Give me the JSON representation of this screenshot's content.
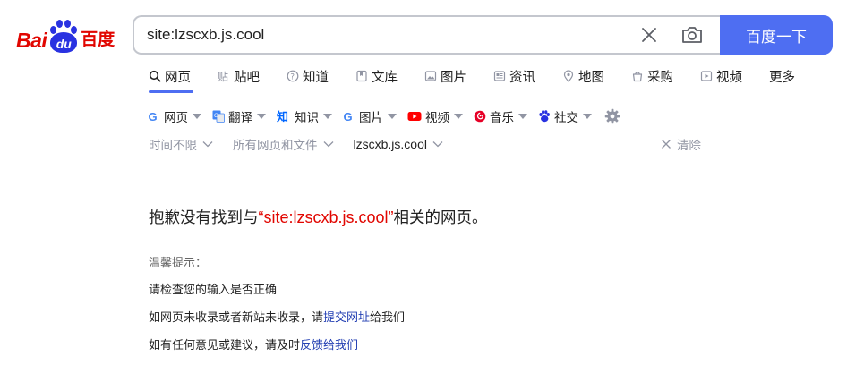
{
  "logo": {
    "latin": "Bai",
    "paw_text": "du",
    "chinese": "百度"
  },
  "search": {
    "query": "site:lzscxb.js.cool",
    "button_label": "百度一下"
  },
  "tabs": [
    {
      "label": "网页",
      "icon": "search-icon",
      "active": true
    },
    {
      "label": "贴吧",
      "icon": "tieba-icon",
      "active": false
    },
    {
      "label": "知道",
      "icon": "question-icon",
      "active": false
    },
    {
      "label": "文库",
      "icon": "document-icon",
      "active": false
    },
    {
      "label": "图片",
      "icon": "image-icon",
      "active": false
    },
    {
      "label": "资讯",
      "icon": "news-icon",
      "active": false
    },
    {
      "label": "地图",
      "icon": "map-pin-icon",
      "active": false
    },
    {
      "label": "采购",
      "icon": "shopping-icon",
      "active": false
    },
    {
      "label": "视频",
      "icon": "video-icon",
      "active": false
    },
    {
      "label": "更多",
      "icon": "",
      "active": false
    }
  ],
  "tools": [
    {
      "label": "网页",
      "icon": "google-icon"
    },
    {
      "label": "翻译",
      "icon": "translate-icon"
    },
    {
      "label": "知识",
      "icon": "zhihu-icon"
    },
    {
      "label": "图片",
      "icon": "google-icon"
    },
    {
      "label": "视频",
      "icon": "youtube-icon"
    },
    {
      "label": "音乐",
      "icon": "netease-music-icon"
    },
    {
      "label": "社交",
      "icon": "baidu-paw-icon"
    }
  ],
  "filters": {
    "time": "时间不限",
    "type": "所有网页和文件",
    "site": "lzscxb.js.cool",
    "clear": "清除"
  },
  "message": {
    "prefix": "抱歉没有找到与",
    "open_quote": "“",
    "query": "site:lzscxb.js.cool",
    "close_quote": "”",
    "suffix": "相关的网页。"
  },
  "tips": {
    "title": "温馨提示：",
    "line1": "请检查您的输入是否正确",
    "line2_prefix": "如网页未收录或者新站未收录，请",
    "line2_link": "提交网址",
    "line2_suffix": "给我们",
    "line3_prefix": "如有任何意见或建议，请及时",
    "line3_link": "反馈给我们"
  },
  "colors": {
    "brand_blue": "#4e6ef2",
    "brand_red": "#e10601",
    "link": "#2440b3",
    "muted": "#9195a3"
  }
}
